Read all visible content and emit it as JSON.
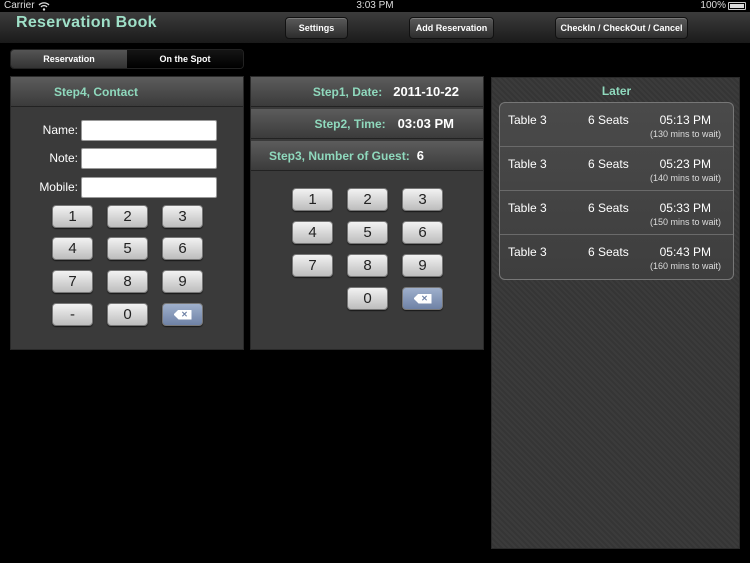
{
  "status_bar": {
    "carrier": "Carrier",
    "time": "3:03 PM",
    "battery": "100%"
  },
  "header": {
    "title": "Reservation Book",
    "settings_label": "Settings",
    "add_label": "Add Reservation",
    "checkin_label": "CheckIn / CheckOut / Cancel"
  },
  "segments": {
    "reservation": "Reservation",
    "on_the_spot": "On the Spot",
    "selected": "Reservation"
  },
  "contact": {
    "title": "Step4, Contact",
    "name_label": "Name:",
    "note_label": "Note:",
    "mobile_label": "Mobile:",
    "name_value": "",
    "note_value": "",
    "mobile_value": "",
    "keys": [
      "1",
      "2",
      "3",
      "4",
      "5",
      "6",
      "7",
      "8",
      "9",
      "-",
      "0"
    ],
    "delete_icon": "backspace-icon"
  },
  "steps": {
    "date_label": "Step1, Date:",
    "date_value": "2011-10-22",
    "time_label": "Step2, Time:",
    "time_value": "03:03 PM",
    "guest_label": "Step3, Number of Guest:",
    "guest_value": "6",
    "keys": [
      "1",
      "2",
      "3",
      "4",
      "5",
      "6",
      "7",
      "8",
      "9",
      "0"
    ],
    "delete_icon": "backspace-icon"
  },
  "later": {
    "title": "Later",
    "items": [
      {
        "table": "Table 3",
        "seats": "6 Seats",
        "time": "05:13 PM",
        "wait": "(130 mins to wait)"
      },
      {
        "table": "Table 3",
        "seats": "6 Seats",
        "time": "05:23 PM",
        "wait": "(140 mins to wait)"
      },
      {
        "table": "Table 3",
        "seats": "6 Seats",
        "time": "05:33 PM",
        "wait": "(150 mins to wait)"
      },
      {
        "table": "Table 3",
        "seats": "6 Seats",
        "time": "05:43 PM",
        "wait": "(160 mins to wait)"
      }
    ]
  },
  "colors": {
    "accent": "#8fd9bd",
    "title": "#9fe0c8",
    "delete_key": "#7f91b4"
  }
}
